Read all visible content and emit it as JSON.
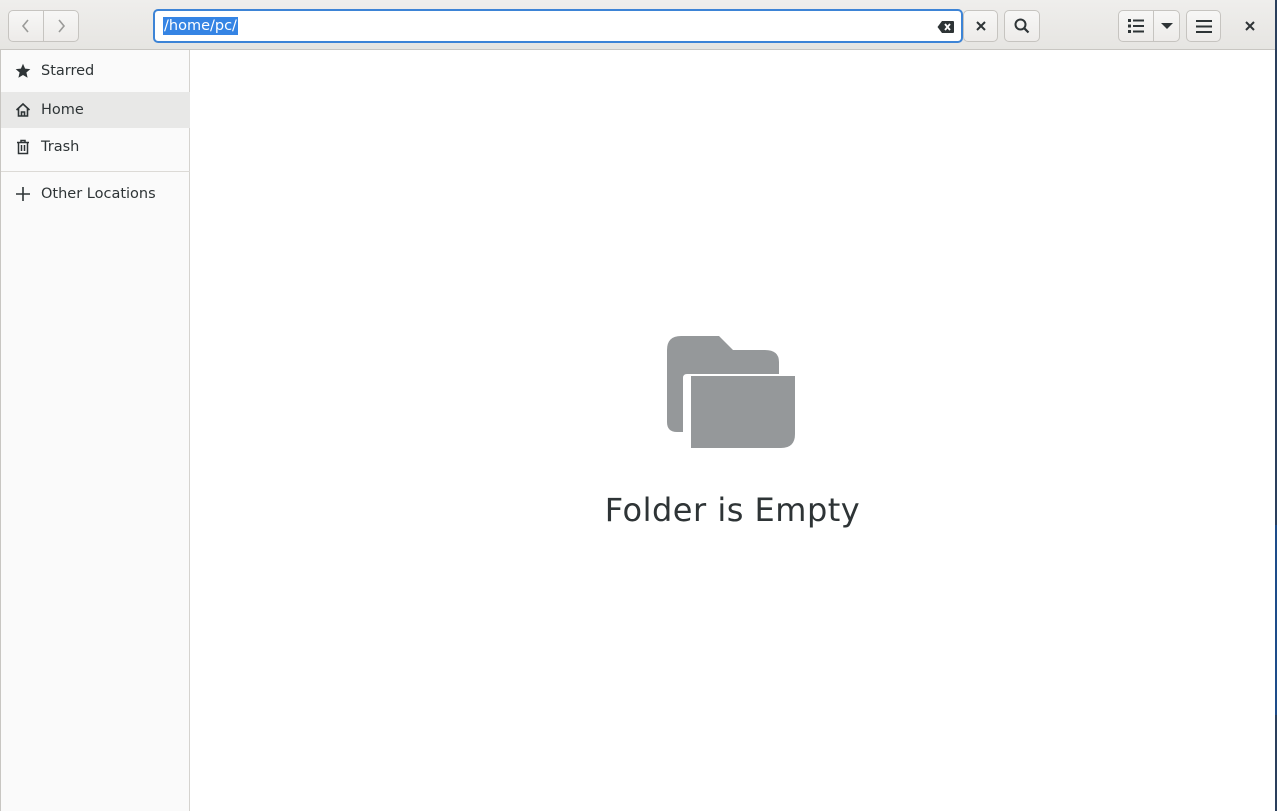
{
  "toolbar": {
    "location_value": "/home/pc/"
  },
  "sidebar": {
    "items": [
      {
        "label": "Starred",
        "icon": "star-icon"
      },
      {
        "label": "Home",
        "icon": "home-icon",
        "active": true
      },
      {
        "label": "Trash",
        "icon": "trash-icon"
      },
      {
        "label": "Other Locations",
        "icon": "plus-icon"
      }
    ]
  },
  "main": {
    "empty_message": "Folder is Empty"
  },
  "colors": {
    "accent": "#3584e4",
    "folder_icon": "#95989a"
  }
}
